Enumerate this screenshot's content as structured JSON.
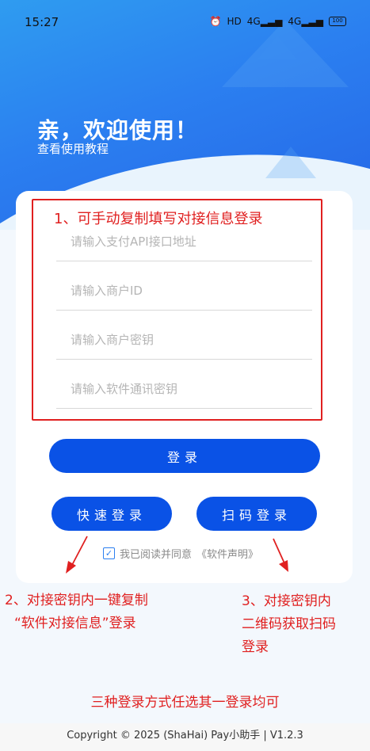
{
  "status_bar": {
    "time": "15:27",
    "hd": "HD",
    "net1": "4G",
    "net2": "4G",
    "battery": "100"
  },
  "hero": {
    "welcome": "亲，欢迎使用！",
    "tutorial_link": "查看使用教程"
  },
  "form": {
    "api_placeholder": "请输入支付API接口地址",
    "merchant_id_placeholder": "请输入商户ID",
    "merchant_key_placeholder": "请输入商户密钥",
    "comm_key_placeholder": "请输入软件通讯密钥",
    "login_label": "登录",
    "quick_login_label": "快速登录",
    "scan_login_label": "扫码登录",
    "agree_prefix": "我已阅读并同意",
    "agree_link": "《软件声明》"
  },
  "annotations": {
    "a1": "1、可手动复制填写对接信息登录",
    "a2_line1": "2、对接密钥内一键复制",
    "a2_line2": "“软件对接信息”登录",
    "a3_line1": "3、对接密钥内",
    "a3_line2": "二维码获取扫码",
    "a3_line3": "登录",
    "bottom": "三种登录方式任选其一登录均可"
  },
  "footer": {
    "copyright": "Copyright © 2025 (ShaHai) Pay小助手 | V1.2.3"
  },
  "colors": {
    "primary": "#0a52e6",
    "annotation": "#e02020",
    "hero": "#2b7ff0"
  }
}
